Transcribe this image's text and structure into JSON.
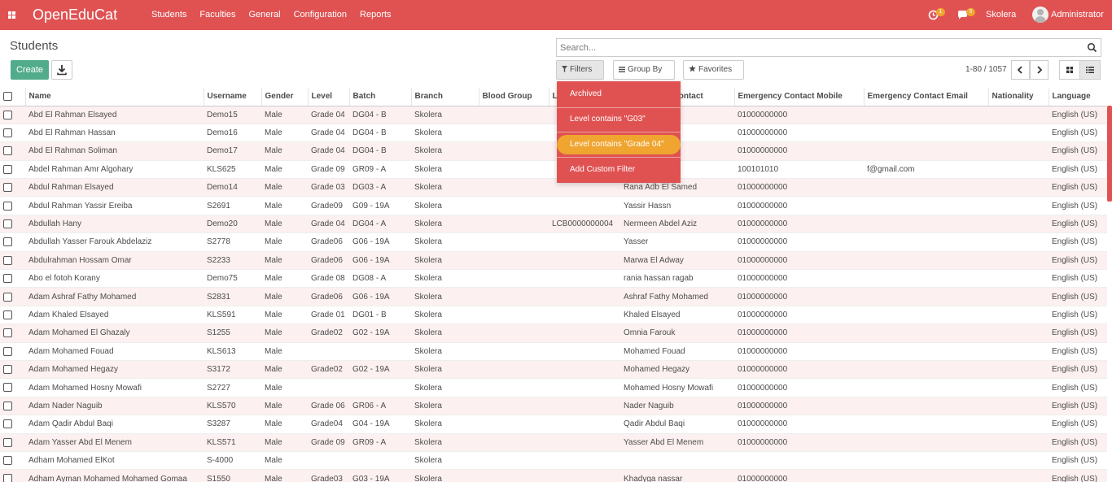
{
  "navbar": {
    "brand": "OpenEduCat",
    "menu": [
      "Students",
      "Faculties",
      "General",
      "Configuration",
      "Reports"
    ],
    "activity_count": "1",
    "messages_count": "5",
    "company": "Skolera",
    "user": "Administrator",
    "color": "#e05252"
  },
  "control": {
    "breadcrumb": "Students",
    "create_label": "Create",
    "search_placeholder": "Search...",
    "filters_label": "Filters",
    "groupby_label": "Group By",
    "favorites_label": "Favorites",
    "pager": "1-80 / 1057"
  },
  "filter_menu": {
    "items": [
      "Archived",
      "Level contains \"G03\"",
      "Level contains \"Grade 04\"",
      "Add Custom Filter"
    ],
    "active_index": 2
  },
  "table": {
    "columns": [
      "Name",
      "Username",
      "Gender",
      "Level",
      "Batch",
      "Branch",
      "Blood Group",
      "L",
      "Contact",
      "Emergency Contact Mobile",
      "Emergency Contact Email",
      "Nationality",
      "Language"
    ],
    "rows": [
      [
        "Abd El Rahman Elsayed",
        "Demo15",
        "Male",
        "Grade 04",
        "DG04 - B",
        "Skolera",
        "",
        "",
        "",
        "01000000000",
        "",
        "",
        "English (US)"
      ],
      [
        "Abd El Rahman Hassan",
        "Demo16",
        "Male",
        "Grade 04",
        "DG04 - B",
        "Skolera",
        "",
        "",
        "",
        "01000000000",
        "",
        "",
        "English (US)"
      ],
      [
        "Abd El Rahman Soliman",
        "Demo17",
        "Male",
        "Grade 04",
        "DG04 - B",
        "Skolera",
        "",
        "",
        "",
        "01000000000",
        "",
        "",
        "English (US)"
      ],
      [
        "Abdel Rahman Amr Algohary",
        "KLS625",
        "Male",
        "Grade 09",
        "GR09 - A",
        "Skolera",
        "",
        "",
        "",
        "100101010",
        "f@gmail.com",
        "",
        "English (US)"
      ],
      [
        "Abdul Rahman Elsayed",
        "Demo14",
        "Male",
        "Grade 03",
        "DG03 - A",
        "Skolera",
        "",
        "",
        "Rana Adb El Samed",
        "01000000000",
        "",
        "",
        "English (US)"
      ],
      [
        "Abdul Rahman Yassir Ereiba",
        "S2691",
        "Male",
        "Grade09",
        "G09 - 19A",
        "Skolera",
        "",
        "",
        "Yassir Hassn",
        "01000000000",
        "",
        "",
        "English (US)"
      ],
      [
        "Abdullah Hany",
        "Demo20",
        "Male",
        "Grade 04",
        "DG04 - A",
        "Skolera",
        "",
        "LCB0000000004",
        "Nermeen Abdel Aziz",
        "01000000000",
        "",
        "",
        "English (US)"
      ],
      [
        "Abdullah Yasser Farouk Abdelaziz",
        "S2778",
        "Male",
        "Grade06",
        "G06 - 19A",
        "Skolera",
        "",
        "",
        "Yasser",
        "01000000000",
        "",
        "",
        "English (US)"
      ],
      [
        "Abdulrahman Hossam Omar",
        "S2233",
        "Male",
        "Grade06",
        "G06 - 19A",
        "Skolera",
        "",
        "",
        "Marwa El Adway",
        "01000000000",
        "",
        "",
        "English (US)"
      ],
      [
        "Abo el fotoh Korany",
        "Demo75",
        "Male",
        "Grade 08",
        "DG08 - A",
        "Skolera",
        "",
        "",
        "rania hassan ragab",
        "01000000000",
        "",
        "",
        "English (US)"
      ],
      [
        "Adam Ashraf Fathy Mohamed",
        "S2831",
        "Male",
        "Grade06",
        "G06 - 19A",
        "Skolera",
        "",
        "",
        "Ashraf Fathy Mohamed",
        "01000000000",
        "",
        "",
        "English (US)"
      ],
      [
        "Adam Khaled Elsayed",
        "KLS591",
        "Male",
        "Grade 01",
        "DG01 - B",
        "Skolera",
        "",
        "",
        "Khaled Elsayed",
        "01000000000",
        "",
        "",
        "English (US)"
      ],
      [
        "Adam Mohamed El Ghazaly",
        "S1255",
        "Male",
        "Grade02",
        "G02 - 19A",
        "Skolera",
        "",
        "",
        "Omnia Farouk",
        "01000000000",
        "",
        "",
        "English (US)"
      ],
      [
        "Adam Mohamed Fouad",
        "KLS613",
        "Male",
        "",
        "",
        "Skolera",
        "",
        "",
        "Mohamed Fouad",
        "01000000000",
        "",
        "",
        "English (US)"
      ],
      [
        "Adam Mohamed Hegazy",
        "S3172",
        "Male",
        "Grade02",
        "G02 - 19A",
        "Skolera",
        "",
        "",
        "Mohamed Hegazy",
        "01000000000",
        "",
        "",
        "English (US)"
      ],
      [
        "Adam Mohamed Hosny Mowafi",
        "S2727",
        "Male",
        "",
        "",
        "Skolera",
        "",
        "",
        "Mohamed Hosny Mowafi",
        "01000000000",
        "",
        "",
        "English (US)"
      ],
      [
        "Adam Nader Naguib",
        "KLS570",
        "Male",
        "Grade 06",
        "GR06 - A",
        "Skolera",
        "",
        "",
        "Nader Naguib",
        "01000000000",
        "",
        "",
        "English (US)"
      ],
      [
        "Adam Qadir Abdul Baqi",
        "S3287",
        "Male",
        "Grade04",
        "G04 - 19A",
        "Skolera",
        "",
        "",
        "Qadir Abdul Baqi",
        "01000000000",
        "",
        "",
        "English (US)"
      ],
      [
        "Adam Yasser Abd El Menem",
        "KLS571",
        "Male",
        "Grade 09",
        "GR09 - A",
        "Skolera",
        "",
        "",
        "Yasser Abd El Menem",
        "01000000000",
        "",
        "",
        "English (US)"
      ],
      [
        "Adham Mohamed ElKot",
        "S-4000",
        "Male",
        "",
        "",
        "Skolera",
        "",
        "",
        "",
        "",
        "",
        "",
        "English (US)"
      ],
      [
        "Adham Ayman Mohamed Mohamed Gomaa",
        "S1550",
        "Male",
        "Grade03",
        "G03 - 19A",
        "Skolera",
        "",
        "",
        "Khadyga nassar",
        "01000000000",
        "",
        "",
        "English (US)"
      ]
    ]
  }
}
